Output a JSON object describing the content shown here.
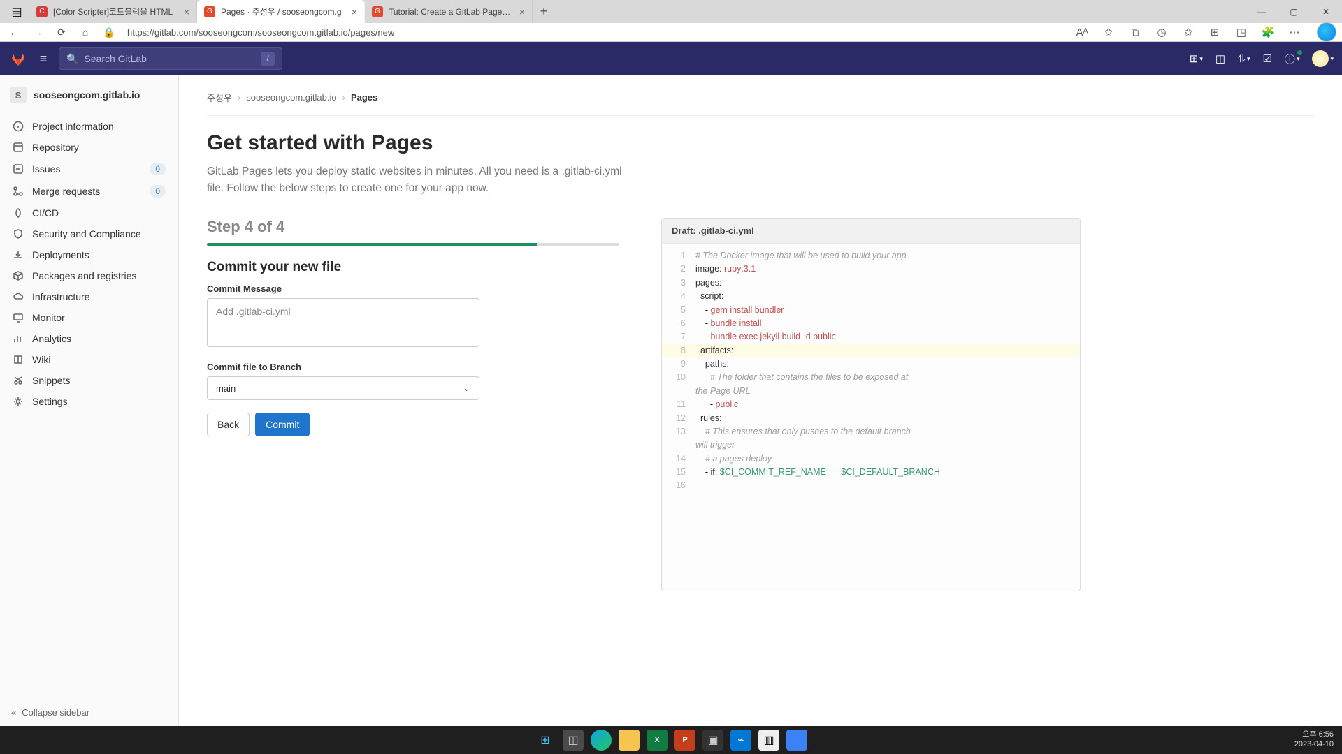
{
  "browser": {
    "tabs": [
      {
        "title": "[Color Scripter]코드블럭을 HTML",
        "favcolor": "#d93a3a"
      },
      {
        "title": "Pages · 주성우 / sooseongcom.g",
        "favcolor": "#e2492f"
      },
      {
        "title": "Tutorial: Create a GitLab Pages w",
        "favcolor": "#e2492f"
      }
    ],
    "url": "https://gitlab.com/sooseongcom/sooseongcom.gitlab.io/pages/new",
    "window": {
      "min": "—",
      "max": "▢",
      "close": "✕"
    }
  },
  "gitlab": {
    "search_placeholder": "Search GitLab",
    "slash": "/"
  },
  "project": {
    "initial": "S",
    "name": "sooseongcom.gitlab.io"
  },
  "sidebar": {
    "items": [
      {
        "label": "Project information"
      },
      {
        "label": "Repository"
      },
      {
        "label": "Issues",
        "badge": "0"
      },
      {
        "label": "Merge requests",
        "badge": "0"
      },
      {
        "label": "CI/CD"
      },
      {
        "label": "Security and Compliance"
      },
      {
        "label": "Deployments"
      },
      {
        "label": "Packages and registries"
      },
      {
        "label": "Infrastructure"
      },
      {
        "label": "Monitor"
      },
      {
        "label": "Analytics"
      },
      {
        "label": "Wiki"
      },
      {
        "label": "Snippets"
      },
      {
        "label": "Settings"
      }
    ],
    "collapse": "Collapse sidebar"
  },
  "crumbs": {
    "a": "주성우",
    "b": "sooseongcom.gitlab.io",
    "c": "Pages"
  },
  "page": {
    "title": "Get started with Pages",
    "lead": "GitLab Pages lets you deploy static websites in minutes. All you need is a .gitlab-ci.yml file. Follow the below steps to create one for your app now.",
    "step": "Step 4 of 4",
    "commit_heading": "Commit your new file",
    "msg_label": "Commit Message",
    "msg_value": "Add .gitlab-ci.yml",
    "branch_label": "Commit file to Branch",
    "branch_value": "main",
    "back": "Back",
    "commit": "Commit"
  },
  "code": {
    "header": "Draft: .gitlab-ci.yml"
  },
  "clock": {
    "time": "오후 6:56",
    "date": "2023-04-10"
  }
}
